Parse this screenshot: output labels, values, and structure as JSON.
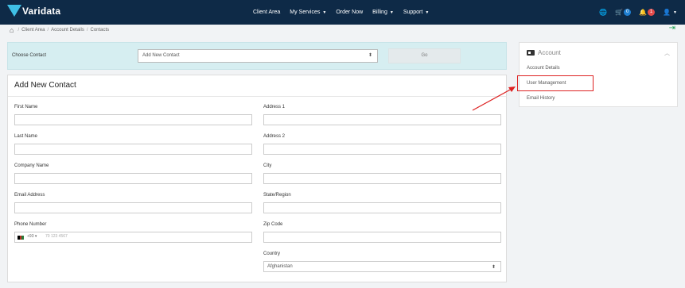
{
  "brand": {
    "name": "Varidata"
  },
  "nav": {
    "items": [
      {
        "label": "Client Area",
        "caret": false
      },
      {
        "label": "My Services",
        "caret": true
      },
      {
        "label": "Order Now",
        "caret": false
      },
      {
        "label": "Billing",
        "caret": true
      },
      {
        "label": "Support",
        "caret": true
      }
    ],
    "cart_count": "0",
    "notifications_count": "1"
  },
  "breadcrumb": [
    "Client Area",
    "Account Details",
    "Contacts"
  ],
  "choose_contact": {
    "label": "Choose Contact",
    "selected": "Add New Contact",
    "go_label": "Go"
  },
  "form": {
    "title": "Add New Contact",
    "left_fields": [
      "First Name",
      "Last Name",
      "Company Name",
      "Email Address",
      "Phone Number"
    ],
    "right_fields": [
      "Address 1",
      "Address 2",
      "City",
      "State/Region",
      "Zip Code"
    ],
    "phone": {
      "code": "+93",
      "placeholder": "70 123 4567"
    },
    "country": {
      "label": "Country",
      "value": "Afghanistan"
    }
  },
  "sidebar": {
    "title": "Account",
    "links": [
      "Account Details",
      "User Management",
      "Email History"
    ],
    "highlighted": "User Management"
  },
  "colors": {
    "navbar": "#0e2a47",
    "brand_accent": "#3fc0e6",
    "choose_bar": "#d6eef1",
    "highlight": "#dd2222"
  }
}
